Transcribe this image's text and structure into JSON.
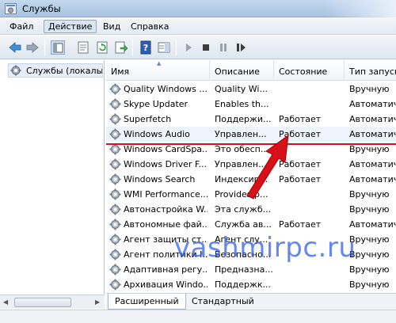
{
  "window": {
    "title": "Службы"
  },
  "menu": [
    "Файл",
    "Действие",
    "Вид",
    "Справка"
  ],
  "toolbar": {
    "icons": [
      "back-icon",
      "forward-icon",
      "console-tree-icon",
      "properties-icon",
      "refresh-icon",
      "export-icon",
      "help-icon",
      "show-hide-icon",
      "play-icon",
      "stop-icon",
      "pause-icon",
      "restart-icon"
    ]
  },
  "tree": {
    "root_label": "Службы (локалы"
  },
  "columns": [
    "Имя",
    "Описание",
    "Состояние",
    "Тип запуска"
  ],
  "rows": [
    {
      "name": "Quality Windows ...",
      "desc": "Quality Wi...",
      "state": "",
      "start": "Вручную"
    },
    {
      "name": "Skype Updater",
      "desc": "Enables th...",
      "state": "",
      "start": "Автоматич"
    },
    {
      "name": "Superfetch",
      "desc": "Поддержи...",
      "state": "Работает",
      "start": "Автоматич"
    },
    {
      "name": "Windows Audio",
      "desc": "Управлен...",
      "state": "Работает",
      "start": "Автоматич"
    },
    {
      "name": "Windows CardSpa...",
      "desc": "Это обесп...",
      "state": "",
      "start": "Вручную"
    },
    {
      "name": "Windows Driver F...",
      "desc": "Управлен...",
      "state": "Работает",
      "start": "Автоматич"
    },
    {
      "name": "Windows Search",
      "desc": "Индексир...",
      "state": "Работает",
      "start": "Автоматич"
    },
    {
      "name": "WMI Performance...",
      "desc": "Provides p...",
      "state": "",
      "start": "Вручную"
    },
    {
      "name": "Автонастройка W...",
      "desc": "Эта служб...",
      "state": "",
      "start": "Вручную"
    },
    {
      "name": "Автономные фай...",
      "desc": "Служба ав...",
      "state": "Работает",
      "start": "Автоматич"
    },
    {
      "name": "Агент защиты ст...",
      "desc": "Агент слу...",
      "state": "",
      "start": "Вручную"
    },
    {
      "name": "Агент политики I...",
      "desc": "Безопасно...",
      "state": "",
      "start": "Вручную"
    },
    {
      "name": "Адаптивная регу...",
      "desc": "Предназна...",
      "state": "",
      "start": "Вручную"
    },
    {
      "name": "Архивация Windo...",
      "desc": "Поддержк...",
      "state": "",
      "start": "Вручную"
    }
  ],
  "tabs": [
    "Расширенный",
    "Стандартный"
  ],
  "watermark": "vashmirpc.ru",
  "colors": {
    "highlight_line": "#d8101a",
    "watermark": "#2a5ae6"
  }
}
